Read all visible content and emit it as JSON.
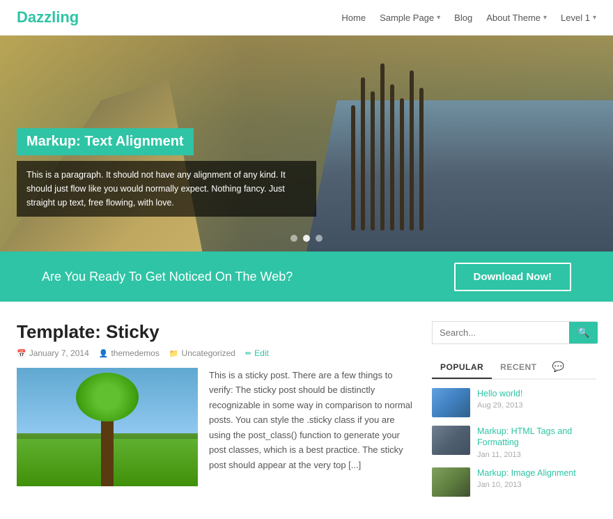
{
  "header": {
    "logo": "Dazzling",
    "nav": [
      {
        "label": "Home",
        "has_dropdown": false
      },
      {
        "label": "Sample Page",
        "has_dropdown": true
      },
      {
        "label": "Blog",
        "has_dropdown": false
      },
      {
        "label": "About Theme",
        "has_dropdown": true
      },
      {
        "label": "Level 1",
        "has_dropdown": true
      }
    ]
  },
  "hero": {
    "title": "Markup: Text Alignment",
    "description": "This is a paragraph. It should not have any alignment of any kind. It should just flow like you would normally expect. Nothing fancy. Just straight up text, free flowing, with love.",
    "dots": [
      false,
      true,
      false
    ]
  },
  "cta": {
    "text": "Are You Ready To Get Noticed On The Web?",
    "button": "Download Now!"
  },
  "post": {
    "title": "Template: Sticky",
    "meta": {
      "date": "January 7, 2014",
      "author": "themedemos",
      "category": "Uncategorized",
      "edit": "Edit"
    },
    "excerpt": "This is a sticky post. There are a few things to verify: The sticky post should be distinctly recognizable in some way in comparison to normal posts. You can style the .sticky class if you are using the post_class() function to generate your post classes, which is a best practice. The sticky post should appear at the very top [...]"
  },
  "sidebar": {
    "search_placeholder": "Search...",
    "tabs": [
      {
        "label": "POPULAR",
        "active": true
      },
      {
        "label": "RECENT",
        "active": false
      }
    ],
    "posts": [
      {
        "title": "Hello world!",
        "date": "Aug 29, 2013",
        "thumb_class": "st-1"
      },
      {
        "title": "Markup: HTML Tags and Formatting",
        "date": "Jan 11, 2013",
        "thumb_class": "st-2"
      },
      {
        "title": "Markup: Image Alignment",
        "date": "Jan 10, 2013",
        "thumb_class": "st-3"
      }
    ]
  },
  "icons": {
    "calendar": "📅",
    "user": "👤",
    "folder": "📁",
    "edit": "✏",
    "search": "🔍",
    "comment": "💬"
  },
  "colors": {
    "accent": "#2ec4a5"
  }
}
